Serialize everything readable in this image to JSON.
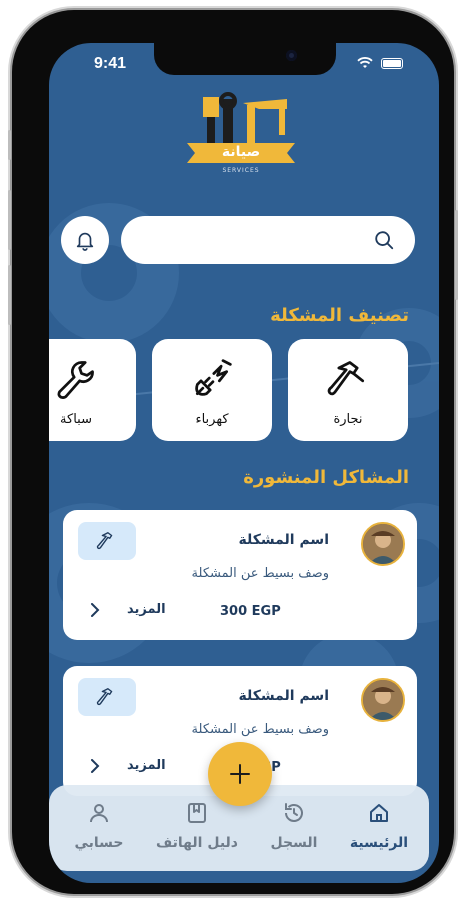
{
  "status_bar": {
    "time": "9:41"
  },
  "header": {
    "logo_text": "صيانة",
    "logo_subtext": "SERVICES"
  },
  "search": {
    "placeholder": ""
  },
  "categories": {
    "title": "تصنيف المشكلة",
    "items": [
      {
        "label": "نجارة",
        "icon": "hammer-icon"
      },
      {
        "label": "كهرباء",
        "icon": "plug-icon"
      },
      {
        "label": "سباكة",
        "icon": "wrench-icon"
      }
    ]
  },
  "posts": {
    "title": "المشاكل المنشورة",
    "items": [
      {
        "title": "اسم المشكلة",
        "description": "وصف بسيط عن المشكلة",
        "price": "300 EGP",
        "more_label": "المزيد",
        "tag_icon": "hammer-icon"
      },
      {
        "title": "اسم المشكلة",
        "description": "وصف بسيط عن المشكلة",
        "price": "300 EGP",
        "more_label": "المزيد",
        "tag_icon": "hammer-icon"
      }
    ]
  },
  "fab": {
    "icon": "plus-icon"
  },
  "tabbar": {
    "items": [
      {
        "label": "الرئيسية",
        "icon": "home-icon",
        "active": true
      },
      {
        "label": "السجل",
        "icon": "history-icon",
        "active": false
      },
      {
        "label": "دليل الهاتف",
        "icon": "book-icon",
        "active": false
      },
      {
        "label": "حسابي",
        "icon": "user-icon",
        "active": false
      }
    ]
  },
  "colors": {
    "background": "#2f5f92",
    "accent": "#f0b83a",
    "text_dark": "#1f3a5c",
    "tag_bg": "#d6e9fa"
  }
}
